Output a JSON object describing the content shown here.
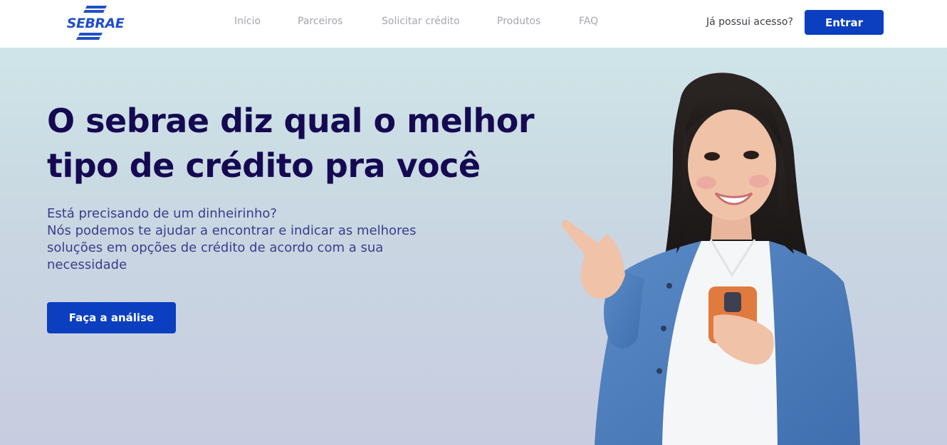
{
  "brand": {
    "logo_text": "SEBRAE",
    "primary_color": "#0b3fbf",
    "title_color": "#150a52"
  },
  "nav": {
    "links": [
      {
        "label": "Início"
      },
      {
        "label": "Parceiros"
      },
      {
        "label": "Solicitar crédito"
      },
      {
        "label": "Produtos"
      },
      {
        "label": "FAQ"
      }
    ],
    "access_prompt": "Já possui acesso?",
    "login_label": "Entrar"
  },
  "hero": {
    "title_lines": [
      "O sebrae diz qual o melhor",
      "tipo de crédito pra você"
    ],
    "description_lines": [
      "Está precisando de um dinheirinho?",
      "Nós podemos te ajudar a encontrar e indicar as melhores",
      "soluções em opções de crédito de acordo com a sua",
      "necessidade"
    ],
    "cta_label": "Faça a análise",
    "photo": "woman-pointing-holding-phone"
  }
}
